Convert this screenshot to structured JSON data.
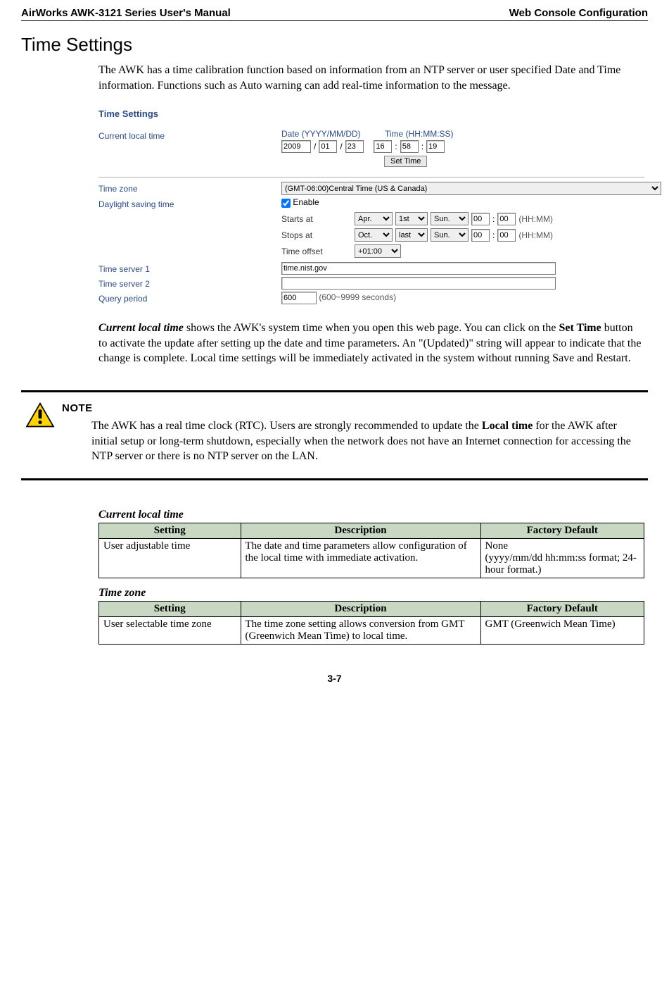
{
  "header": {
    "left": "AirWorks AWK-3121 Series User's Manual",
    "right": "Web Console Configuration"
  },
  "h1": "Time Settings",
  "intro1": "The AWK has a time calibration function based on information from an NTP server or user specified Date and Time information. Functions such as Auto warning can add real-time information to the message.",
  "panel": {
    "title": "Time Settings",
    "labels": {
      "current": "Current local time",
      "date_head": "Date (YYYY/MM/DD)",
      "time_head": "Time (HH:MM:SS)",
      "set_btn": "Set Time",
      "tz": "Time zone",
      "dst": "Daylight saving time",
      "enable": "Enable",
      "starts": "Starts at",
      "stops": "Stops at",
      "offset": "Time offset",
      "ts1": "Time server 1",
      "ts2": "Time server 2",
      "qp": "Query period",
      "qp_note": "(600~9999 seconds)",
      "hhmm": "(HH:MM)"
    },
    "vals": {
      "yyyy": "2009",
      "mm": "01",
      "dd": "23",
      "hh": "16",
      "mi": "58",
      "ss": "19",
      "tz": "(GMT-06:00)Central Time (US & Canada)",
      "start_mo": "Apr.",
      "start_wk": "1st",
      "start_dy": "Sun.",
      "start_h": "00",
      "start_m": "00",
      "stop_mo": "Oct.",
      "stop_wk": "last",
      "stop_dy": "Sun.",
      "stop_h": "00",
      "stop_m": "00",
      "offset": "+01:00",
      "ts1": "time.nist.gov",
      "ts2": "",
      "qp": "600"
    }
  },
  "intro2_pre": "Current local time",
  "intro2_mid1": " shows the AWK's system time when you open this web page. You can click on the ",
  "intro2_set": "Set Time",
  "intro2_mid2": " button to activate the update after setting up the date and time parameters. An \"(Updated)\" string will appear to indicate that the change is complete. Local time settings will be immediately activated in the system without running Save and Restart.",
  "note": {
    "title": "NOTE",
    "t1": "The AWK has a real time clock (RTC). Users are strongly recommended to update the ",
    "t_bold": "Local time",
    "t2": " for the AWK after initial setup or long-term shutdown, especially when the network does not have an Internet connection for accessing the NTP server or there is no NTP server on the LAN."
  },
  "tbl_current": {
    "title": "Current local time",
    "h": {
      "s": "Setting",
      "d": "Description",
      "f": "Factory Default"
    },
    "r": {
      "s": "User adjustable time",
      "d": "The date and time parameters allow configuration of the local time with immediate activation.",
      "f": "None\n(yyyy/mm/dd hh:mm:ss format; 24-hour format.)"
    }
  },
  "tbl_tz": {
    "title": "Time zone",
    "h": {
      "s": "Setting",
      "d": "Description",
      "f": "Factory Default"
    },
    "r": {
      "s": "User selectable time zone",
      "d": "The time zone setting allows conversion from GMT (Greenwich Mean Time) to local time.",
      "f": "GMT (Greenwich Mean Time)"
    }
  },
  "page_num": "3-7"
}
